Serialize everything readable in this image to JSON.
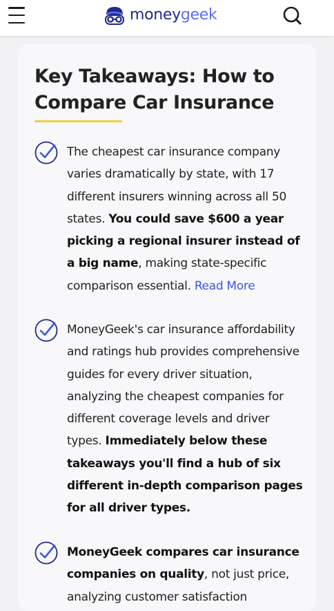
{
  "header": {
    "logo": {
      "text_money": "money",
      "text_geek": "geek"
    }
  },
  "card": {
    "title": "Key Takeaways: How to Compare Car Insurance",
    "colors": {
      "underline": "#f5cb3f",
      "check": "#3c59d6",
      "link": "#3c59d6"
    },
    "takeaways": [
      {
        "icon": "check-circle-icon",
        "parts": [
          {
            "text": "The cheapest car insurance company varies dramatically by state, with 17 different insurers winning across all 50 states. "
          },
          {
            "text": "You could save $600 a year picking a regional insurer instead of a big name",
            "bold": true
          },
          {
            "text": ", making state-specific comparison essential. "
          },
          {
            "text": "Read More",
            "link": true
          }
        ]
      },
      {
        "icon": "check-circle-icon",
        "parts": [
          {
            "text": "MoneyGeek's car insurance affordability and ratings hub provides comprehensive guides for every driver situation, analyzing the cheapest companies for different coverage levels and driver types. "
          },
          {
            "text": "Immediately below these takeaways you'll find a hub of six different in-depth comparison pages for all driver types.",
            "bold": true
          }
        ]
      },
      {
        "icon": "check-circle-icon",
        "parts": [
          {
            "text": "MoneyGeek compares car insurance companies on quality",
            "bold": true
          },
          {
            "text": ", not just price, analyzing customer satisfaction"
          }
        ]
      }
    ]
  }
}
